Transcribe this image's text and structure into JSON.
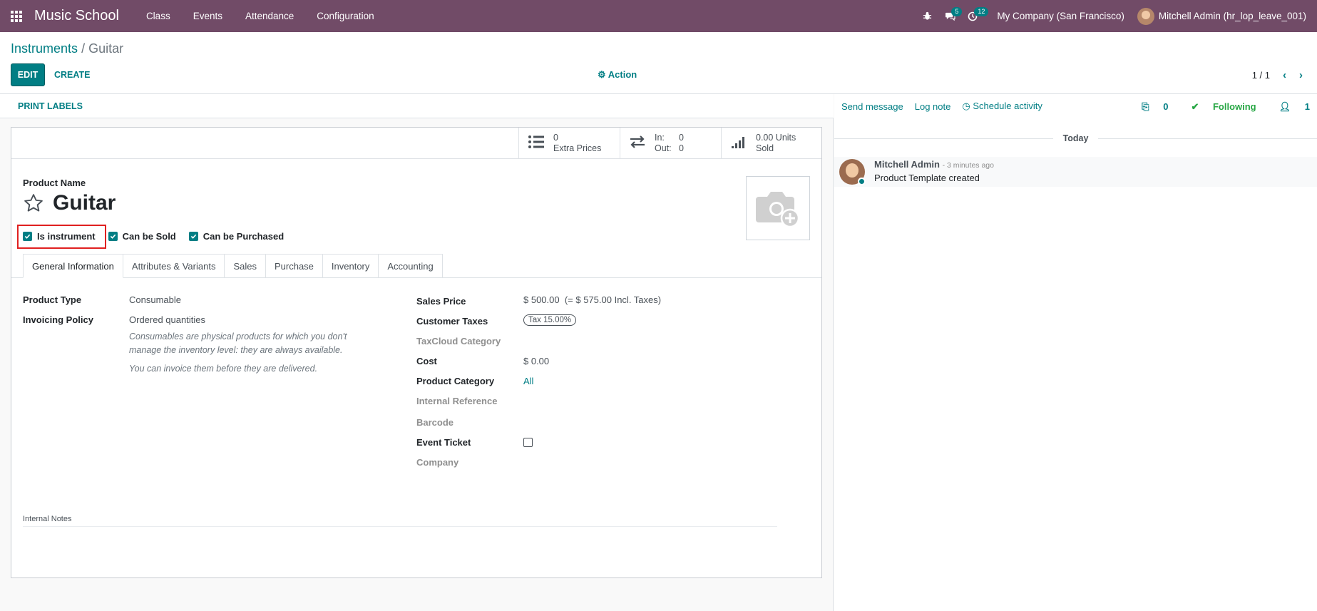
{
  "navbar": {
    "brand": "Music School",
    "menu": [
      "Class",
      "Events",
      "Attendance",
      "Configuration"
    ],
    "messages_count": "5",
    "activities_count": "12",
    "company": "My Company (San Francisco)",
    "user": "Mitchell Admin (hr_lop_leave_001)"
  },
  "breadcrumb": {
    "parent": "Instruments",
    "separator": "/",
    "current": "Guitar"
  },
  "toolbar": {
    "edit": "EDIT",
    "create": "CREATE",
    "action": "Action",
    "pager": "1 / 1"
  },
  "statusbar": {
    "print_labels": "PRINT LABELS"
  },
  "stats": {
    "extra_prices_count": "0",
    "extra_prices_label": "Extra Prices",
    "in_label": "In:",
    "in_value": "0",
    "out_label": "Out:",
    "out_value": "0",
    "sold_value": "0.00 Units",
    "sold_label": "Sold"
  },
  "product": {
    "name_label": "Product Name",
    "name": "Guitar",
    "checkboxes": [
      {
        "label": "Is instrument",
        "checked": true
      },
      {
        "label": "Can be Sold",
        "checked": true
      },
      {
        "label": "Can be Purchased",
        "checked": true
      }
    ]
  },
  "tabs": [
    "General Information",
    "Attributes & Variants",
    "Sales",
    "Purchase",
    "Inventory",
    "Accounting"
  ],
  "left_fields": {
    "product_type_label": "Product Type",
    "product_type": "Consumable",
    "invoicing_policy_label": "Invoicing Policy",
    "invoicing_policy": "Ordered quantities",
    "help_1": "Consumables are physical products for which you don't manage the inventory level: they are always available.",
    "help_2": "You can invoice them before they are delivered."
  },
  "right_fields": {
    "sales_price_label": "Sales Price",
    "sales_price": "$ 500.00",
    "sales_price_incl": "(= $ 575.00 Incl. Taxes)",
    "customer_taxes_label": "Customer Taxes",
    "customer_tax": "Tax 15.00%",
    "taxcloud_label": "TaxCloud Category",
    "cost_label": "Cost",
    "cost": "$ 0.00",
    "category_label": "Product Category",
    "category": "All",
    "internal_ref_label": "Internal Reference",
    "barcode_label": "Barcode",
    "event_ticket_label": "Event Ticket",
    "event_ticket": false,
    "company_label": "Company"
  },
  "notes": {
    "label": "Internal Notes"
  },
  "chatter": {
    "send_message": "Send message",
    "log_note": "Log note",
    "schedule_activity": "Schedule activity",
    "attachments": "0",
    "following": "Following",
    "followers": "1",
    "today": "Today",
    "message": {
      "author": "Mitchell Admin",
      "time": "- 3 minutes ago",
      "body": "Product Template created"
    }
  },
  "colors": {
    "navbar": "#714B67",
    "accent": "#017E84",
    "highlight": "#e02020"
  }
}
